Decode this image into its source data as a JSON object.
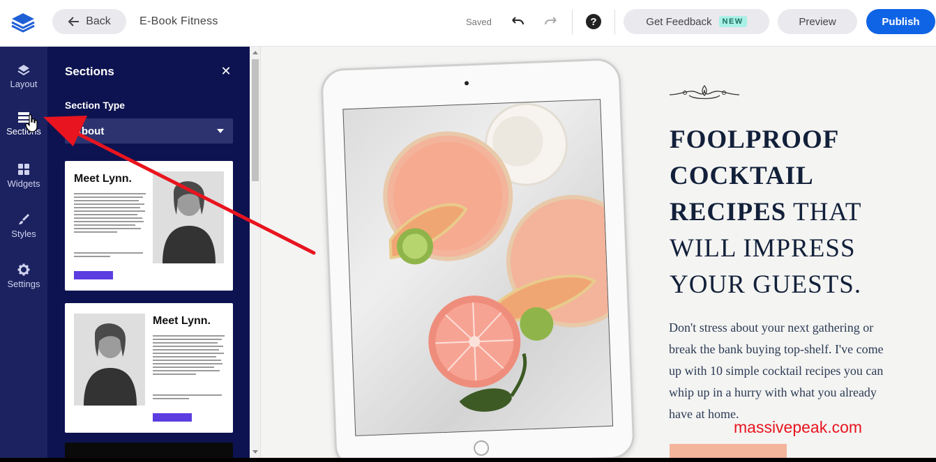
{
  "topbar": {
    "back_label": "Back",
    "document_title": "E-Book Fitness",
    "saved_label": "Saved",
    "feedback_label": "Get Feedback",
    "new_badge": "NEW",
    "preview_label": "Preview",
    "publish_label": "Publish"
  },
  "leftnav": {
    "items": [
      {
        "label": "Layout",
        "icon": "layers-icon"
      },
      {
        "label": "Sections",
        "icon": "sections-icon"
      },
      {
        "label": "Widgets",
        "icon": "widgets-icon"
      },
      {
        "label": "Styles",
        "icon": "brush-icon"
      },
      {
        "label": "Settings",
        "icon": "gear-icon"
      }
    ]
  },
  "panel": {
    "title": "Sections",
    "section_type_label": "Section Type",
    "section_type_value": "About",
    "thumbnails": [
      {
        "heading": "Meet Lynn."
      },
      {
        "heading": "Meet Lynn."
      }
    ]
  },
  "canvas": {
    "hero_title_bold": "FOOLPROOF COCKTAIL RECIPES",
    "hero_title_rest": " THAT WILL IMPRESS YOUR GUESTS.",
    "hero_body": "Don't stress about your next gathering or break the bank buying top-shelf. I've come up with 10 simple cocktail recipes you can whip up in a hurry with what you already have at home."
  },
  "watermark": "massivepeak.com",
  "colors": {
    "publish": "#0f64e6",
    "nav_bg": "#1c2260",
    "panel_bg": "#0d1350",
    "annotation_arrow": "#e8141f"
  }
}
